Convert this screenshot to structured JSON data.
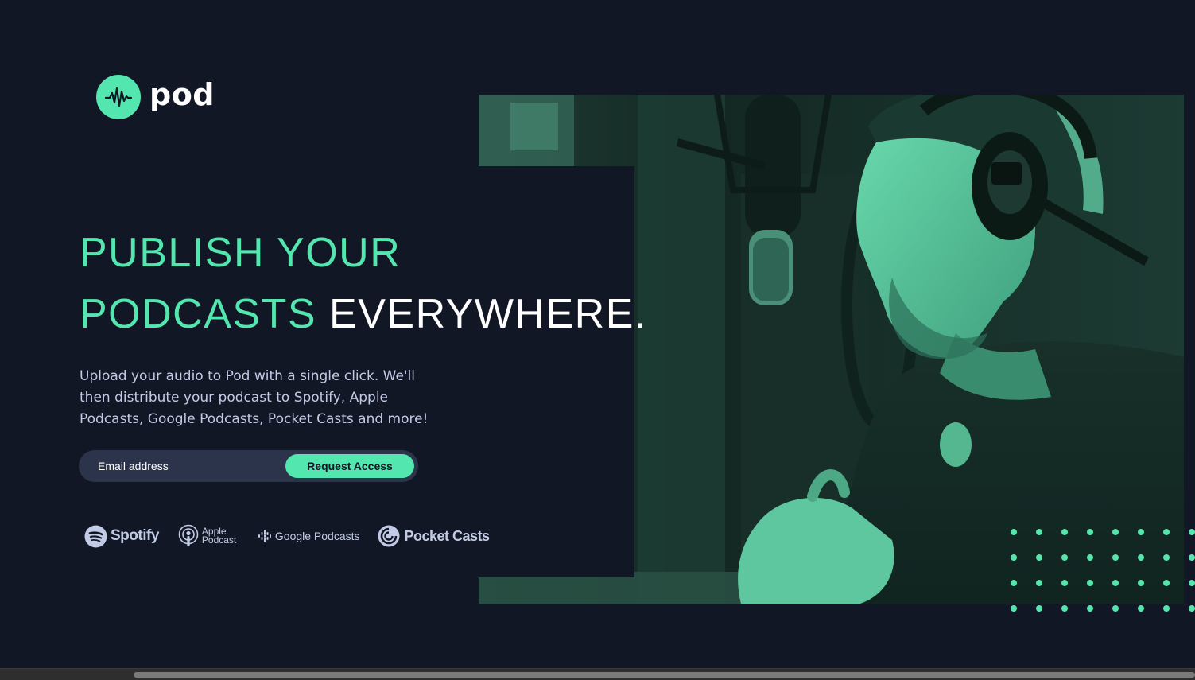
{
  "brand": {
    "name": "pod",
    "logo_icon": "waveform-icon",
    "accent_color": "#54E6AF",
    "background_color": "#121725"
  },
  "hero": {
    "headline_line1": "PUBLISH YOUR",
    "headline_line2_accent": "PODCASTS",
    "headline_line2_white": "EVERYWHERE.",
    "description_lines": [
      "Upload your audio to Pod with a single click. We'll",
      "then distribute your podcast to Spotify, Apple",
      "Podcasts, Google Podcasts, Pocket Casts and more!"
    ],
    "image_description": "Man wearing headphones and backwards cap speaking into a studio microphone, green-tinted duotone photo"
  },
  "form": {
    "email_placeholder": "Email address",
    "email_value": "",
    "submit_label": "Request Access"
  },
  "platforms": [
    {
      "name": "Spotify",
      "icon": "spotify-icon"
    },
    {
      "name_line1": "Apple",
      "name_line2": "Podcast",
      "icon": "apple-podcasts-icon"
    },
    {
      "name": "Google Podcasts",
      "icon": "google-podcasts-icon"
    },
    {
      "name": "Pocket Casts",
      "icon": "pocket-casts-icon"
    }
  ],
  "decor": {
    "dot_grid_color": "#54E6AF"
  }
}
